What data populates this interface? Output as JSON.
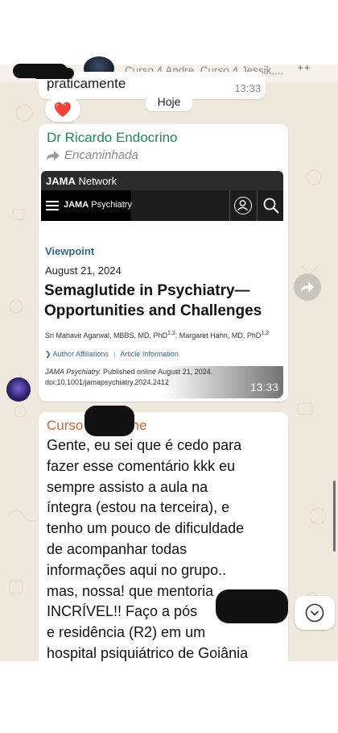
{
  "header": {
    "group_title": "Curso 4 Andre, Curso 4 Jessik,..."
  },
  "previous_message": {
    "text": "praticamente",
    "time": "13:33",
    "reaction": "❤️"
  },
  "date_divider": "Hoje",
  "forwarded_message": {
    "sender": "Dr Ricardo Endocrino",
    "forwarded_label": "Encaminhada",
    "time": "13:33",
    "link_preview": {
      "network_brand_bold": "JAMA",
      "network_brand_rest": " Network",
      "journal_bold": "JAMA",
      "journal_rest": " Psychiatry",
      "section": "Viewpoint",
      "date": "August 21, 2024",
      "title": "Semaglutide in Psychiatry— Opportunities and Challenges",
      "author1": "Sri Mahavir Agarwal, MBBS, MD, PhD",
      "author1_sup": "1,2",
      "author_sep": "; ",
      "author2": "Margaret Hahn, MD, PhD",
      "author2_sup": "1,2",
      "link_affiliations": "Author Affiliations",
      "link_sep": "|",
      "link_info": "Article Information",
      "citation_journal": "JAMA Psychiatry.",
      "citation_published": " Published online August 21, 2024.",
      "citation_doi": "doi:10.1001/jamapsychiatry.2024.2412"
    }
  },
  "next_message": {
    "sender_visible": "Curso",
    "sender_suffix": "ane",
    "lines": [
      "Gente, eu sei que é cedo para",
      "fazer esse comentário kkk eu",
      "sempre assisto a aula na",
      "íntegra (estou na terceira), e",
      "tenho um pouco de dificuldade",
      "de acompanhar todas",
      "informações aqui no grupo..",
      "mas, nossa! que mentoria",
      "INCRÍVEL!! Faço a pós",
      "e residência (R2) em um",
      "hospital psiquiátrico de Goiânia"
    ]
  },
  "colors": {
    "sender1": "#1e8a5a",
    "sender2": "#c8663b",
    "link": "#2d6a8e",
    "chat_bg": "#efe8dc"
  },
  "icons": [
    "pin-icon",
    "forward-icon",
    "menu-icon",
    "user-icon",
    "search-icon",
    "share-icon",
    "chevron-down-icon"
  ]
}
